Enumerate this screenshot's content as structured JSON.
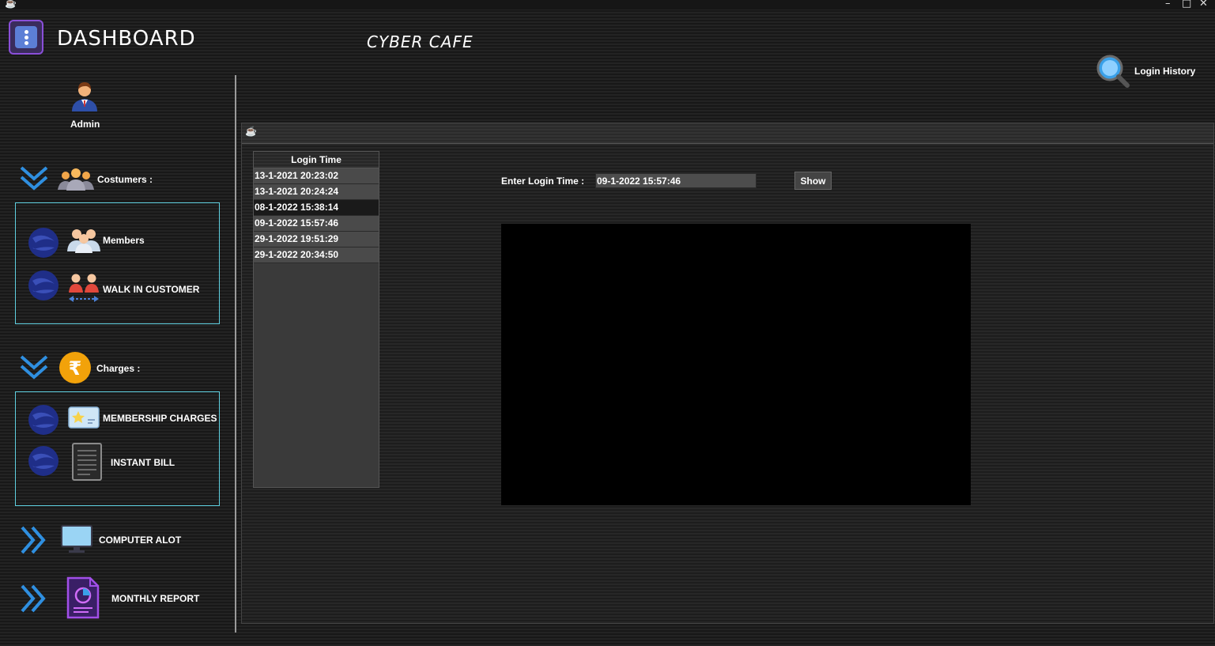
{
  "window": {
    "icon": "coffee-cup-icon",
    "minimize": "–",
    "maximize": "□",
    "close": "✕"
  },
  "header": {
    "title": "DASHBOARD",
    "app_name": "CYBER CAFE",
    "login_history_label": "Login History"
  },
  "sidebar": {
    "user_label": "Admin",
    "customers": {
      "label": "Costumers :",
      "items": [
        {
          "label": "Members"
        },
        {
          "label": "WALK IN CUSTOMER"
        }
      ]
    },
    "charges": {
      "label": "Charges :",
      "items": [
        {
          "label": "MEMBERSHIP CHARGES"
        },
        {
          "label": "INSTANT BILL"
        }
      ]
    },
    "computer_alot_label": "COMPUTER  ALOT",
    "monthly_report_label": "MONTHLY REPORT"
  },
  "main": {
    "table": {
      "header": "Login Time",
      "rows": [
        "13-1-2021 20:23:02",
        "13-1-2021 20:24:24",
        "08-1-2022 15:38:14",
        "09-1-2022 15:57:46",
        "29-1-2022 19:51:29",
        "29-1-2022 20:34:50"
      ],
      "selected_index": 2
    },
    "enter_label": "Enter Login Time :",
    "login_time_value": "09-1-2022 15:57:46",
    "show_label": "Show"
  },
  "colors": {
    "accent_border": "#5fd0e0",
    "chevron_blue": "#2f8fe0",
    "menu_purple": "#8a4fd8",
    "rupee_orange": "#f2a20a"
  }
}
